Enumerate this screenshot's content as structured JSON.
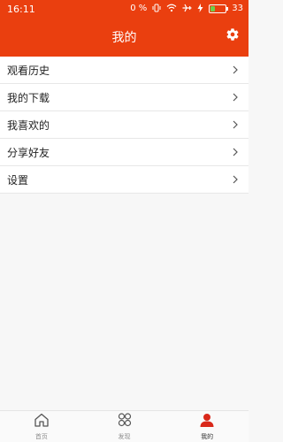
{
  "status_bar": {
    "time": "16:11",
    "data_rate": "0 %",
    "battery_level": "33",
    "battery_fill_percent": 33
  },
  "header": {
    "title": "我的",
    "color": "#ea3f0f"
  },
  "menu": [
    {
      "label": "观看历史"
    },
    {
      "label": "我的下载"
    },
    {
      "label": "我喜欢的"
    },
    {
      "label": "分享好友"
    },
    {
      "label": "设置"
    }
  ],
  "tabs": [
    {
      "label": "首页",
      "icon": "home-icon"
    },
    {
      "label": "发现",
      "icon": "discover-icon"
    },
    {
      "label": "我的",
      "icon": "profile-icon"
    }
  ]
}
